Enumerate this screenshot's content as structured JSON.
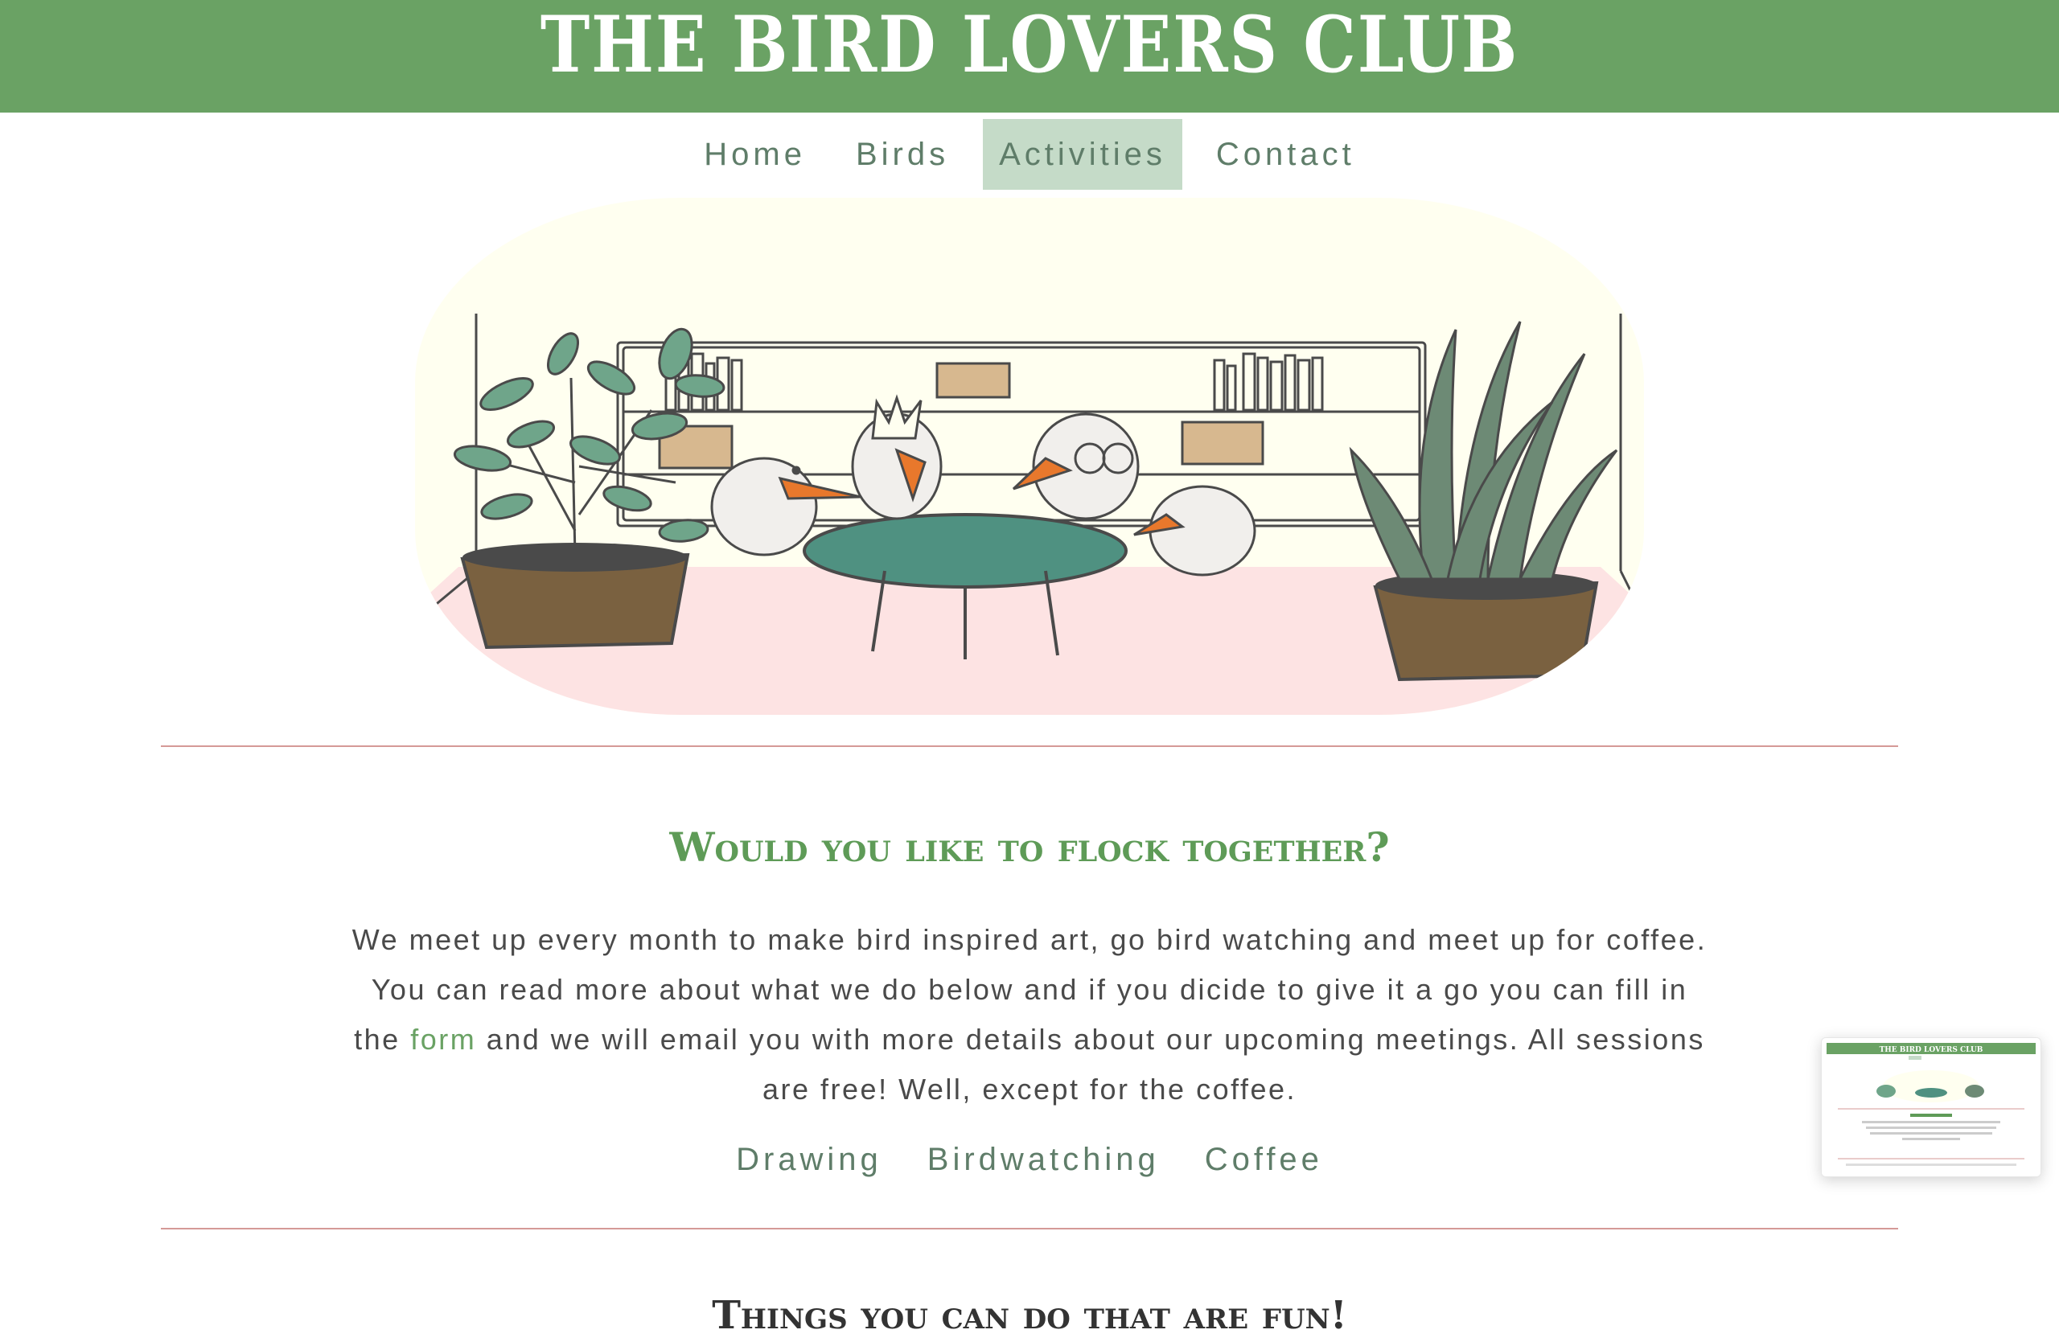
{
  "header": {
    "title": "THE BIRD LOVERS CLUB"
  },
  "nav": {
    "items": [
      {
        "label": "Home",
        "active": false
      },
      {
        "label": "Birds",
        "active": false
      },
      {
        "label": "Activities",
        "active": true
      },
      {
        "label": "Contact",
        "active": false
      }
    ]
  },
  "hero": {
    "illustration": "bird-meeting-illustration"
  },
  "section": {
    "heading": "Would you like to flock together?",
    "intro_part1": "We meet up every month to make bird inspired art, go bird watching and meet up for coffee. You can read more about what we do below and if you dicide to give it a go you can fill in the ",
    "intro_link": "form",
    "intro_part2": " and we will email you with more details about our upcoming meetings. All sessions are free! Well, except for the coffee."
  },
  "sub_nav": {
    "items": [
      "Drawing",
      "Birdwatching",
      "Coffee"
    ]
  },
  "next_section": {
    "heading": "Things you can do that are fun!"
  },
  "preview_thumbnail": {
    "title": "THE BIRD LOVERS CLUB"
  },
  "colors": {
    "header_bg": "#6aa264",
    "nav_active_bg": "#c5dbc8",
    "heading_green": "#5e9b57",
    "divider": "#d59a97"
  }
}
